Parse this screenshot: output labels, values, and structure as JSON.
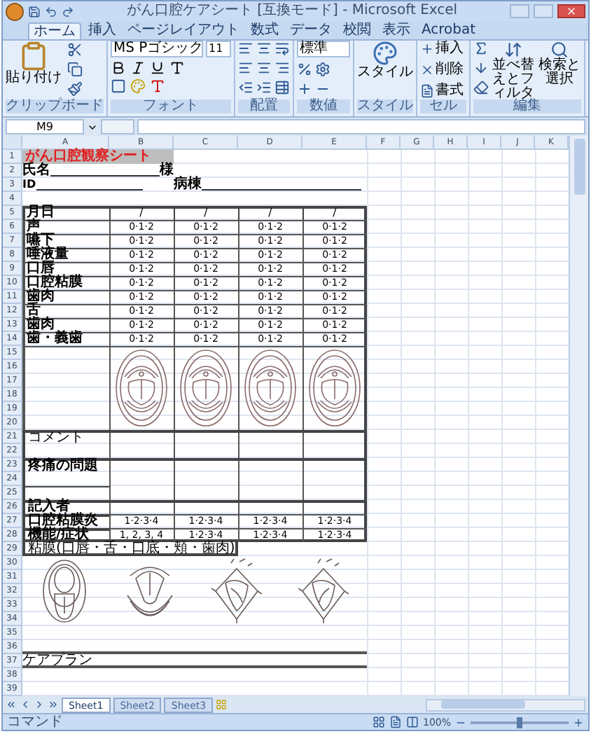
{
  "window": {
    "title": "がん口腔ケアシート [互換モード] - Microsoft Excel"
  },
  "ribbon_tabs": [
    {
      "label": "ホーム",
      "selected": true
    },
    {
      "label": "挿入",
      "selected": false
    },
    {
      "label": "ページレイアウト",
      "selected": false
    },
    {
      "label": "数式",
      "selected": false
    },
    {
      "label": "データ",
      "selected": false
    },
    {
      "label": "校閲",
      "selected": false
    },
    {
      "label": "表示",
      "selected": false
    },
    {
      "label": "Acrobat",
      "selected": false
    }
  ],
  "ribbon_groups": [
    {
      "kind": "clipboard",
      "label": "クリップボード",
      "buttons": [
        "貼り付け"
      ]
    },
    {
      "kind": "font",
      "label": "フォント",
      "font_name": "MS Pゴシック",
      "font_size": "11"
    },
    {
      "kind": "alignment",
      "label": "配置"
    },
    {
      "kind": "number",
      "label": "数値",
      "format": "標準"
    },
    {
      "kind": "styles",
      "label": "スタイル",
      "buttons": [
        "スタイル"
      ]
    },
    {
      "kind": "cells",
      "label": "セル",
      "buttons": [
        "挿入",
        "削除",
        "書式"
      ]
    },
    {
      "kind": "editing",
      "label": "編集",
      "buttons": [
        "並べ替えとフィルタ",
        "検索と選択"
      ]
    }
  ],
  "formula_bar": {
    "name_box": "M9"
  },
  "columns": [
    "A",
    "B",
    "C",
    "D",
    "E",
    "F",
    "G",
    "H",
    "I",
    "J",
    "K"
  ],
  "row_numbers": [
    "1",
    "2",
    "3",
    "4",
    "5",
    "6",
    "7",
    "8",
    "9",
    "10",
    "11",
    "12",
    "13",
    "14",
    "15",
    "16",
    "17",
    "18",
    "19",
    "20",
    "21",
    "22",
    "23",
    "24",
    "25",
    "26",
    "27",
    "28",
    "29",
    "30",
    "31",
    "32",
    "33",
    "34",
    "35",
    "36",
    "37",
    "38",
    "39"
  ],
  "sheet": {
    "title": "がん口腔観察シート",
    "name_label": "氏名",
    "name_suffix": "様",
    "id_label": "ID",
    "ward_label": "病棟",
    "date_header": "月日",
    "dates": [
      "/",
      "/",
      "/",
      "/"
    ],
    "items": [
      {
        "label": "声",
        "values": [
          "0·1·2",
          "0·1·2",
          "0·1·2",
          "0·1·2"
        ]
      },
      {
        "label": "嚥下",
        "values": [
          "0·1·2",
          "0·1·2",
          "0·1·2",
          "0·1·2"
        ]
      },
      {
        "label": "唾液量",
        "values": [
          "0·1·2",
          "0·1·2",
          "0·1·2",
          "0·1·2"
        ]
      },
      {
        "label": "口唇",
        "values": [
          "0·1·2",
          "0·1·2",
          "0·1·2",
          "0·1·2"
        ]
      },
      {
        "label": "口腔粘膜",
        "values": [
          "0·1·2",
          "0·1·2",
          "0·1·2",
          "0·1·2"
        ]
      },
      {
        "label": "歯肉",
        "values": [
          "0·1·2",
          "0·1·2",
          "0·1·2",
          "0·1·2"
        ]
      },
      {
        "label": "舌",
        "values": [
          "0·1·2",
          "0·1·2",
          "0·1·2",
          "0·1·2"
        ]
      },
      {
        "label": "歯肉",
        "values": [
          "0·1·2",
          "0·1·2",
          "0·1·2",
          "0·1·2"
        ]
      },
      {
        "label": "歯・義歯",
        "values": [
          "0·1·2",
          "0·1·2",
          "0·1·2",
          "0·1·2"
        ]
      }
    ],
    "comment_label": "コメント",
    "pain_label": "疼痛の問題",
    "recorder_label": "記入者",
    "grades": [
      {
        "label": "口腔粘膜炎",
        "values": [
          "1·2·3·4",
          "1·2·3·4",
          "1·2·3·4",
          "1·2·3·4"
        ]
      },
      {
        "label": "機能/症状",
        "values": [
          "1, 2, 3, 4",
          "1·2·3·4",
          "1·2·3·4",
          "1·2·3·4"
        ]
      }
    ],
    "note": "粘膜(口唇・舌・口底・頬・歯肉)",
    "care_plan_label": "ケアプラン"
  },
  "sheet_tabs": [
    {
      "label": "Sheet1",
      "selected": true
    },
    {
      "label": "Sheet2",
      "selected": false
    },
    {
      "label": "Sheet3",
      "selected": false
    }
  ],
  "status_bar": {
    "mode": "コマンド",
    "zoom": "100%",
    "zoom_slider": {
      "level": 0.5
    }
  }
}
